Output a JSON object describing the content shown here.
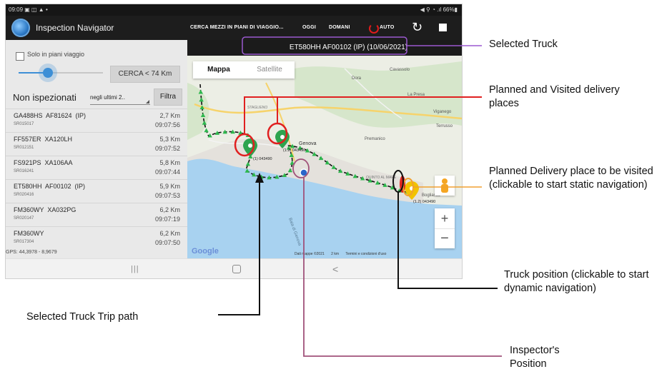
{
  "statusbar": {
    "left": "09:09 ▣ ◫ ▲ •",
    "right": "◀ ⚲ ◔ .ıl 66%▮"
  },
  "app": {
    "title": "Inspection Navigator",
    "actions": {
      "cerca_mezzi": "CERCA MEZZI IN PIANI DI VIAGGIO...",
      "oggi": "OGGI",
      "domani": "DOMANI",
      "auto": "AUTO"
    },
    "icons": {
      "logo": "globe-icon",
      "auto": "power-icon",
      "refresh": "refresh-icon",
      "stop": "stop-icon"
    }
  },
  "left_panel": {
    "checkbox_label": "Solo in piani viaggio",
    "search_button": "CERCA < 74 Km",
    "filter_label": "Non ispezionati",
    "period_select": "negli ultimi 2..",
    "filter_button": "Filtra",
    "slider_fraction": 0.35,
    "trucks": [
      {
        "plate": "GA488HS  AF81624  (IP)",
        "sr": "SR015017",
        "km": "2,7 Km",
        "time": "09:07:56"
      },
      {
        "plate": "FF557ER  XA120LH",
        "sr": "SR012151",
        "km": "5,3 Km",
        "time": "09:07:52"
      },
      {
        "plate": "FS921PS  XA106AA",
        "sr": "SR016241",
        "km": "5,8 Km",
        "time": "09:07:44"
      },
      {
        "plate": "ET580HH  AF00102  (IP)",
        "sr": "SR020416",
        "km": "5,9 Km",
        "time": "09:07:53"
      },
      {
        "plate": "FM360WY  XA032PG",
        "sr": "SR020147",
        "km": "6,2 Km",
        "time": "09:07:19"
      },
      {
        "plate": "FM360WY",
        "sr": "SR017304",
        "km": "6,2 Km",
        "time": "09:07:50"
      }
    ],
    "gps": "GPS: 44,3978 - 8,9679"
  },
  "map": {
    "selected_truck": "ET580HH  AF00102  (IP) (10/06/2021)",
    "tabs": {
      "mappa": "Mappa",
      "satellite": "Satellite"
    },
    "zoom_in": "+",
    "zoom_out": "−",
    "google": "Google",
    "footer": {
      "data": "Dati mappe ©2021",
      "scale": "2 km",
      "terms": "Termini e condizioni d'uso"
    },
    "places": {
      "dora": "Dora",
      "cavassolo": "Cavassolo",
      "la_presa": "La Presa",
      "viganego": "Viganego",
      "terrusso": "Terrusso",
      "premanico": "Premanico",
      "genova": "Genova",
      "staglieno": "STAGLIENO",
      "quinto": "QUINTO AL MARE",
      "bogliasco": "Bogliasco",
      "baia": "Baia di Genova"
    },
    "markers": {
      "visited_1": "(1) 043490",
      "visited_2": "(1.2) 043490",
      "planned": "(1.2) 043490"
    },
    "colors": {
      "route": "#111111",
      "trip_points": "#2db84d",
      "visited_marker": "#2ea44f",
      "planned_marker": "#f2c200",
      "truck": "#e0261f",
      "inspector": "#2b65c9",
      "sea": "#a8d2f0"
    }
  },
  "navbar": {
    "recents": "|||",
    "back": "<"
  },
  "annotations": {
    "selected_truck": "Selected Truck",
    "planned_visited": "Planned and Visited delivery places",
    "planned_delivery": "Planned Delivery place to be visited (clickable to start static navigation)",
    "truck_position": "Truck position (clickable to start dynamic navigation)",
    "trip_path": "Selected Truck Trip path",
    "inspector": "Inspector's Position",
    "colors": {
      "selected": "#9b59d0",
      "red": "#e02020",
      "orange": "#f0a030",
      "black": "#111111",
      "inspector": "#a0527a"
    }
  }
}
